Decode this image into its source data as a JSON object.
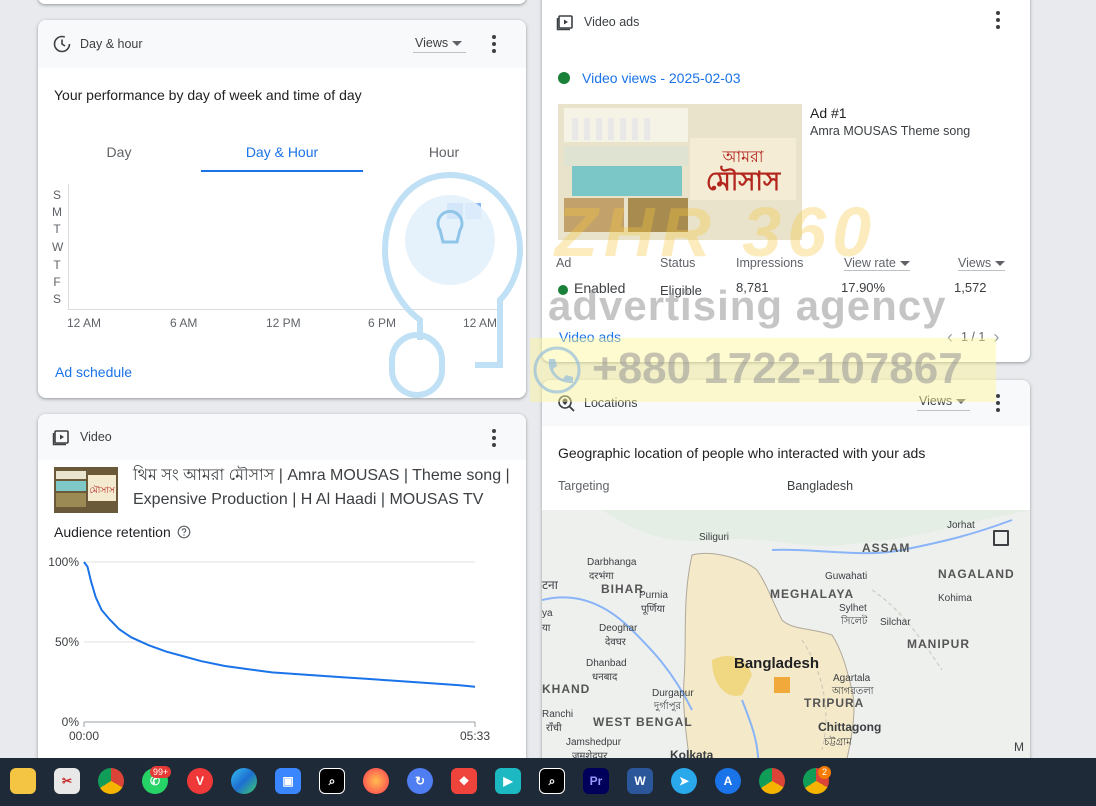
{
  "day_hour": {
    "title": "Day & hour",
    "views_label": "Views",
    "subtitle": "Your performance by day of week and time of day",
    "tabs": [
      "Day",
      "Day & Hour",
      "Hour"
    ],
    "days": [
      "S",
      "M",
      "T",
      "W",
      "T",
      "F",
      "S"
    ],
    "hours": [
      "12 AM",
      "6 AM",
      "12 PM",
      "6 PM",
      "12 AM"
    ],
    "ad_schedule_link": "Ad schedule",
    "heat_color_dark": "#4285f4",
    "heat_color_light": "#8ab4f8"
  },
  "video": {
    "title": "Video",
    "video_title": "থিম সং আমরা মৌসাস | Amra MOUSAS | Theme song | Expensive Production | H Al Haadi | MOUSAS TV",
    "retention_label": "Audience retention",
    "help_icon": "help-circle-icon"
  },
  "chart_data": {
    "type": "line",
    "title": "Audience retention",
    "xlabel": "",
    "ylabel": "",
    "x_ticks": [
      "00:00",
      "05:33"
    ],
    "y_ticks": [
      "100%",
      "50%",
      "0%"
    ],
    "ylim": [
      0,
      100
    ],
    "grid": true,
    "series": [
      {
        "values": [
          [
            0,
            100
          ],
          [
            3,
            97
          ],
          [
            6,
            88
          ],
          [
            10,
            78
          ],
          [
            15,
            70
          ],
          [
            22,
            64
          ],
          [
            30,
            58
          ],
          [
            40,
            53
          ],
          [
            55,
            48
          ],
          [
            70,
            44
          ],
          [
            85,
            41
          ],
          [
            100,
            38
          ],
          [
            120,
            35
          ],
          [
            140,
            33
          ],
          [
            160,
            31
          ],
          [
            180,
            30
          ],
          [
            200,
            29
          ],
          [
            220,
            28
          ],
          [
            240,
            27
          ],
          [
            260,
            26
          ],
          [
            280,
            25
          ],
          [
            300,
            24
          ],
          [
            320,
            23
          ],
          [
            333,
            22
          ]
        ],
        "color": "#1a73e8"
      }
    ]
  },
  "video_ads": {
    "title": "Video ads",
    "views_line": "Video views - 2025-02-03",
    "ad_number": "Ad #1",
    "ad_name": "Amra MOUSAS Theme song",
    "headers": [
      "Ad",
      "Status",
      "Impressions",
      "View rate",
      "Views"
    ],
    "row": [
      "Enabled",
      "Eligible",
      "8,781",
      "17.90%",
      "1,572"
    ],
    "footer_link": "Video ads",
    "pagination": "1 / 1",
    "enabled_color": "#188038"
  },
  "locations": {
    "title": "Locations",
    "views_label": "Views",
    "subtitle": "Geographic location of people who interacted with your ads",
    "targeting_label": "Targeting",
    "targeting_value": "Bangladesh",
    "map_labels": {
      "siliguri": "Siliguri",
      "assam": "ASSAM",
      "jorhat": "Jorhat",
      "darbhanga": "Darbhanga",
      "darbhanga_local": "दरभंगा",
      "patna": "टना",
      "bihar": "BIHAR",
      "guwahati": "Guwahati",
      "nagaland": "NAGALAND",
      "meghalaya": "MEGHALAYA",
      "kohima": "Kohima",
      "purnia": "Purnia",
      "purnia_local": "पूर्णिया",
      "sylhet": "Sylhet",
      "sylhet_local": "সিলেট",
      "silchar": "Silchar",
      "gaya": "ya",
      "gaya2": "या",
      "deoghar": "Deoghar",
      "deoghar_local": "देवघर",
      "manipur": "MANIPUR",
      "dhanbad": "Dhanbad",
      "dhanbad_local": "धनबाद",
      "bangladesh": "Bangladesh",
      "agartala": "Agartala",
      "agartala_local": "আগরতলা",
      "jharkhand": "KHAND",
      "durgapur": "Durgapur",
      "durgapur_local": "দুর্গাপুর",
      "tripura": "TRIPURA",
      "ranchi": "Ranchi",
      "ranchi_local": "राँची",
      "west_bengal": "WEST BENGAL",
      "chittagong": "Chittagong",
      "chittagong_local": "চট্টগ্রাম",
      "jamshedpur": "Jamshedpur",
      "jamshedpur_local": "जमशेदपुर",
      "kolkata": "Kolkata",
      "mizoram": "M"
    }
  },
  "watermark": {
    "brand": "ZHR 360",
    "tagline": "advertising agency",
    "phone": "+880 1722-107867"
  },
  "taskbar": {
    "whatsapp_badge": "99+",
    "chrome_badge": "2",
    "apps": [
      "file-explorer-icon",
      "snipping-tool-icon",
      "chrome-icon",
      "whatsapp-icon",
      "vivaldi-icon",
      "edge-icon",
      "store-icon",
      "capcut-icon",
      "firefox-icon",
      "sync-icon",
      "anydesk-icon",
      "filmora-icon",
      "capcut2-icon",
      "premiere-icon",
      "word-icon",
      "telegram-icon",
      "app-store-icon",
      "chrome-profile-icon",
      "chrome-profile2-icon"
    ]
  }
}
